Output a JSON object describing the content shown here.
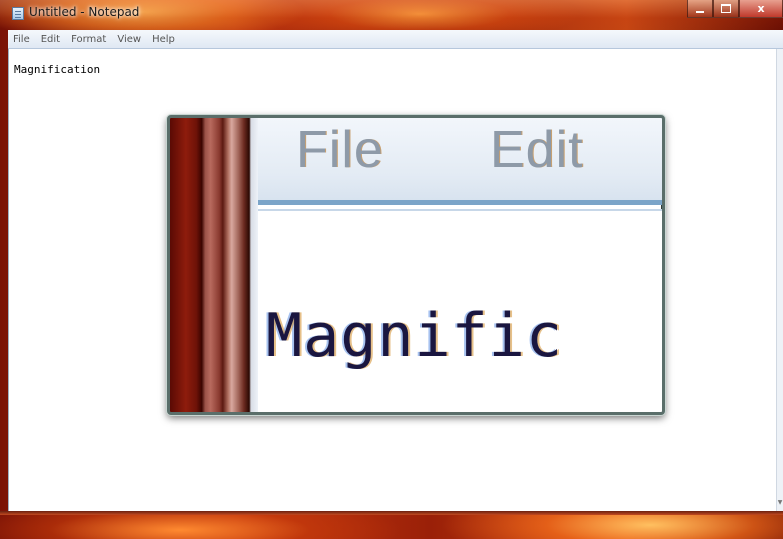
{
  "window": {
    "title": "Untitled - Notepad",
    "close_glyph": "x"
  },
  "menu": [
    "File",
    "Edit",
    "Format",
    "View",
    "Help"
  ],
  "editor": {
    "content": "Magnification"
  },
  "magnifier": {
    "menu": [
      "File",
      "Edit"
    ],
    "content": "Magnific"
  },
  "icons": [
    "notepad-app-icon",
    "minimize-icon",
    "maximize-icon",
    "close-icon"
  ]
}
